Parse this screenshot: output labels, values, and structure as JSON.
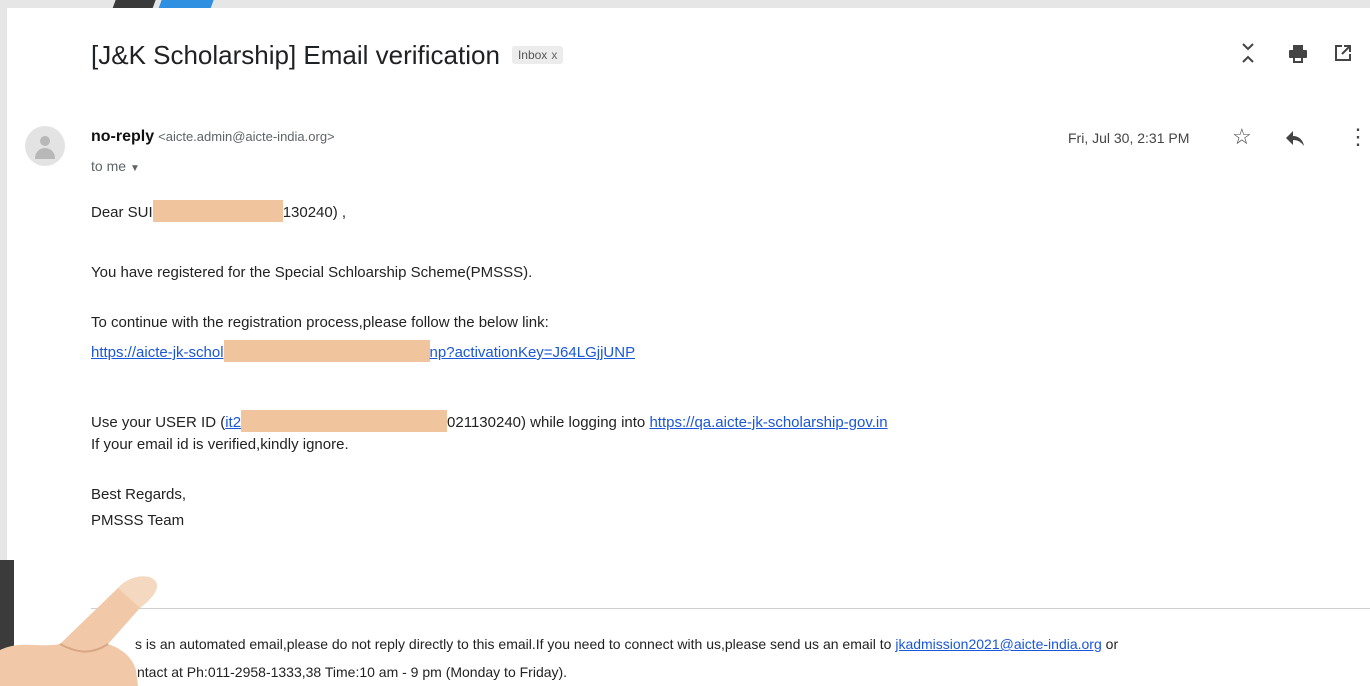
{
  "subject": "[J&K Scholarship] Email verification",
  "label": {
    "text": "Inbox",
    "close": "x"
  },
  "toolbar": {
    "collapse_icon": "expand-collapse-icon",
    "print_icon": "print-icon",
    "open_icon": "open-in-new-window-icon"
  },
  "sender": {
    "name": "no-reply",
    "email": "<aicte.admin@aicte-india.org>",
    "to": "to me"
  },
  "date": "Fri, Jul 30, 2:31 PM",
  "body": {
    "greeting_prefix": "Dear SUI",
    "greeting_suffix": "130240) ,",
    "line1": "You have registered for the Special Schloarship Scheme(PMSSS).",
    "line2": "To continue with the registration process,please follow the below link:",
    "link_prefix": "https://aicte-jk-schol",
    "link_suffix": "np?activationKey=J64LGjjUNP",
    "userid_prefix": "Use your USER ID (",
    "userid_link": "it2",
    "userid_suffix": "021130240) while logging into ",
    "login_link": "https://qa.aicte-jk-scholarship-gov.in",
    "line4": "If your email id is verified,kindly ignore.",
    "regards": "Best Regards,",
    "team": "PMSSS Team"
  },
  "footer": {
    "line1_text": "s is an automated email,please do not reply directly to this email.If you need to connect with us,please send us an email to ",
    "email_link": "jkadmission2021@aicte-india.org",
    "line1_end": " or",
    "line2": "ntact at Ph:011-2958-1333,38 Time:10 am - 9 pm (Monday to Friday)."
  }
}
